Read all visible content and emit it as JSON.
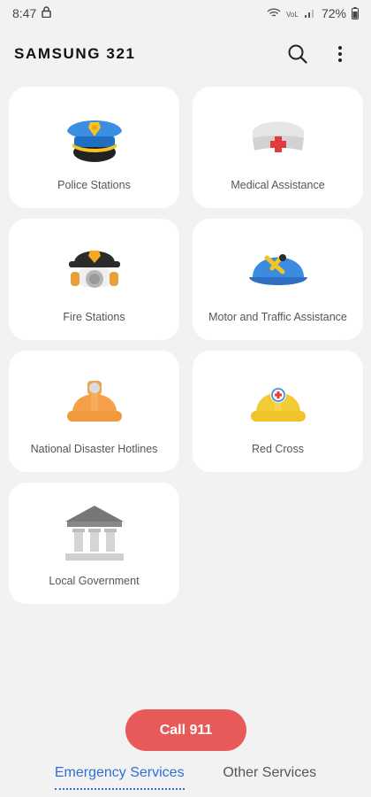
{
  "status_bar": {
    "time": "8:47",
    "battery": "72%"
  },
  "header": {
    "title": "SAMSUNG 321"
  },
  "services": [
    {
      "label": "Police Stations",
      "icon": "police-cap-icon"
    },
    {
      "label": "Medical Assistance",
      "icon": "nurse-cap-icon"
    },
    {
      "label": "Fire Stations",
      "icon": "firefighter-helmet-icon"
    },
    {
      "label": "Motor and Traffic Assistance",
      "icon": "mechanic-cap-icon"
    },
    {
      "label": "National Disaster Hotlines",
      "icon": "miner-helmet-icon"
    },
    {
      "label": "Red Cross",
      "icon": "red-cross-helmet-icon"
    },
    {
      "label": "Local Government",
      "icon": "government-building-icon"
    }
  ],
  "call_button": {
    "label": "Call 911"
  },
  "tabs": [
    {
      "label": "Emergency Services",
      "active": true
    },
    {
      "label": "Other Services",
      "active": false
    }
  ],
  "colors": {
    "background": "#f2f2f2",
    "card": "#ffffff",
    "call_button": "#e85a5a",
    "active_tab": "#2f6fd6"
  }
}
